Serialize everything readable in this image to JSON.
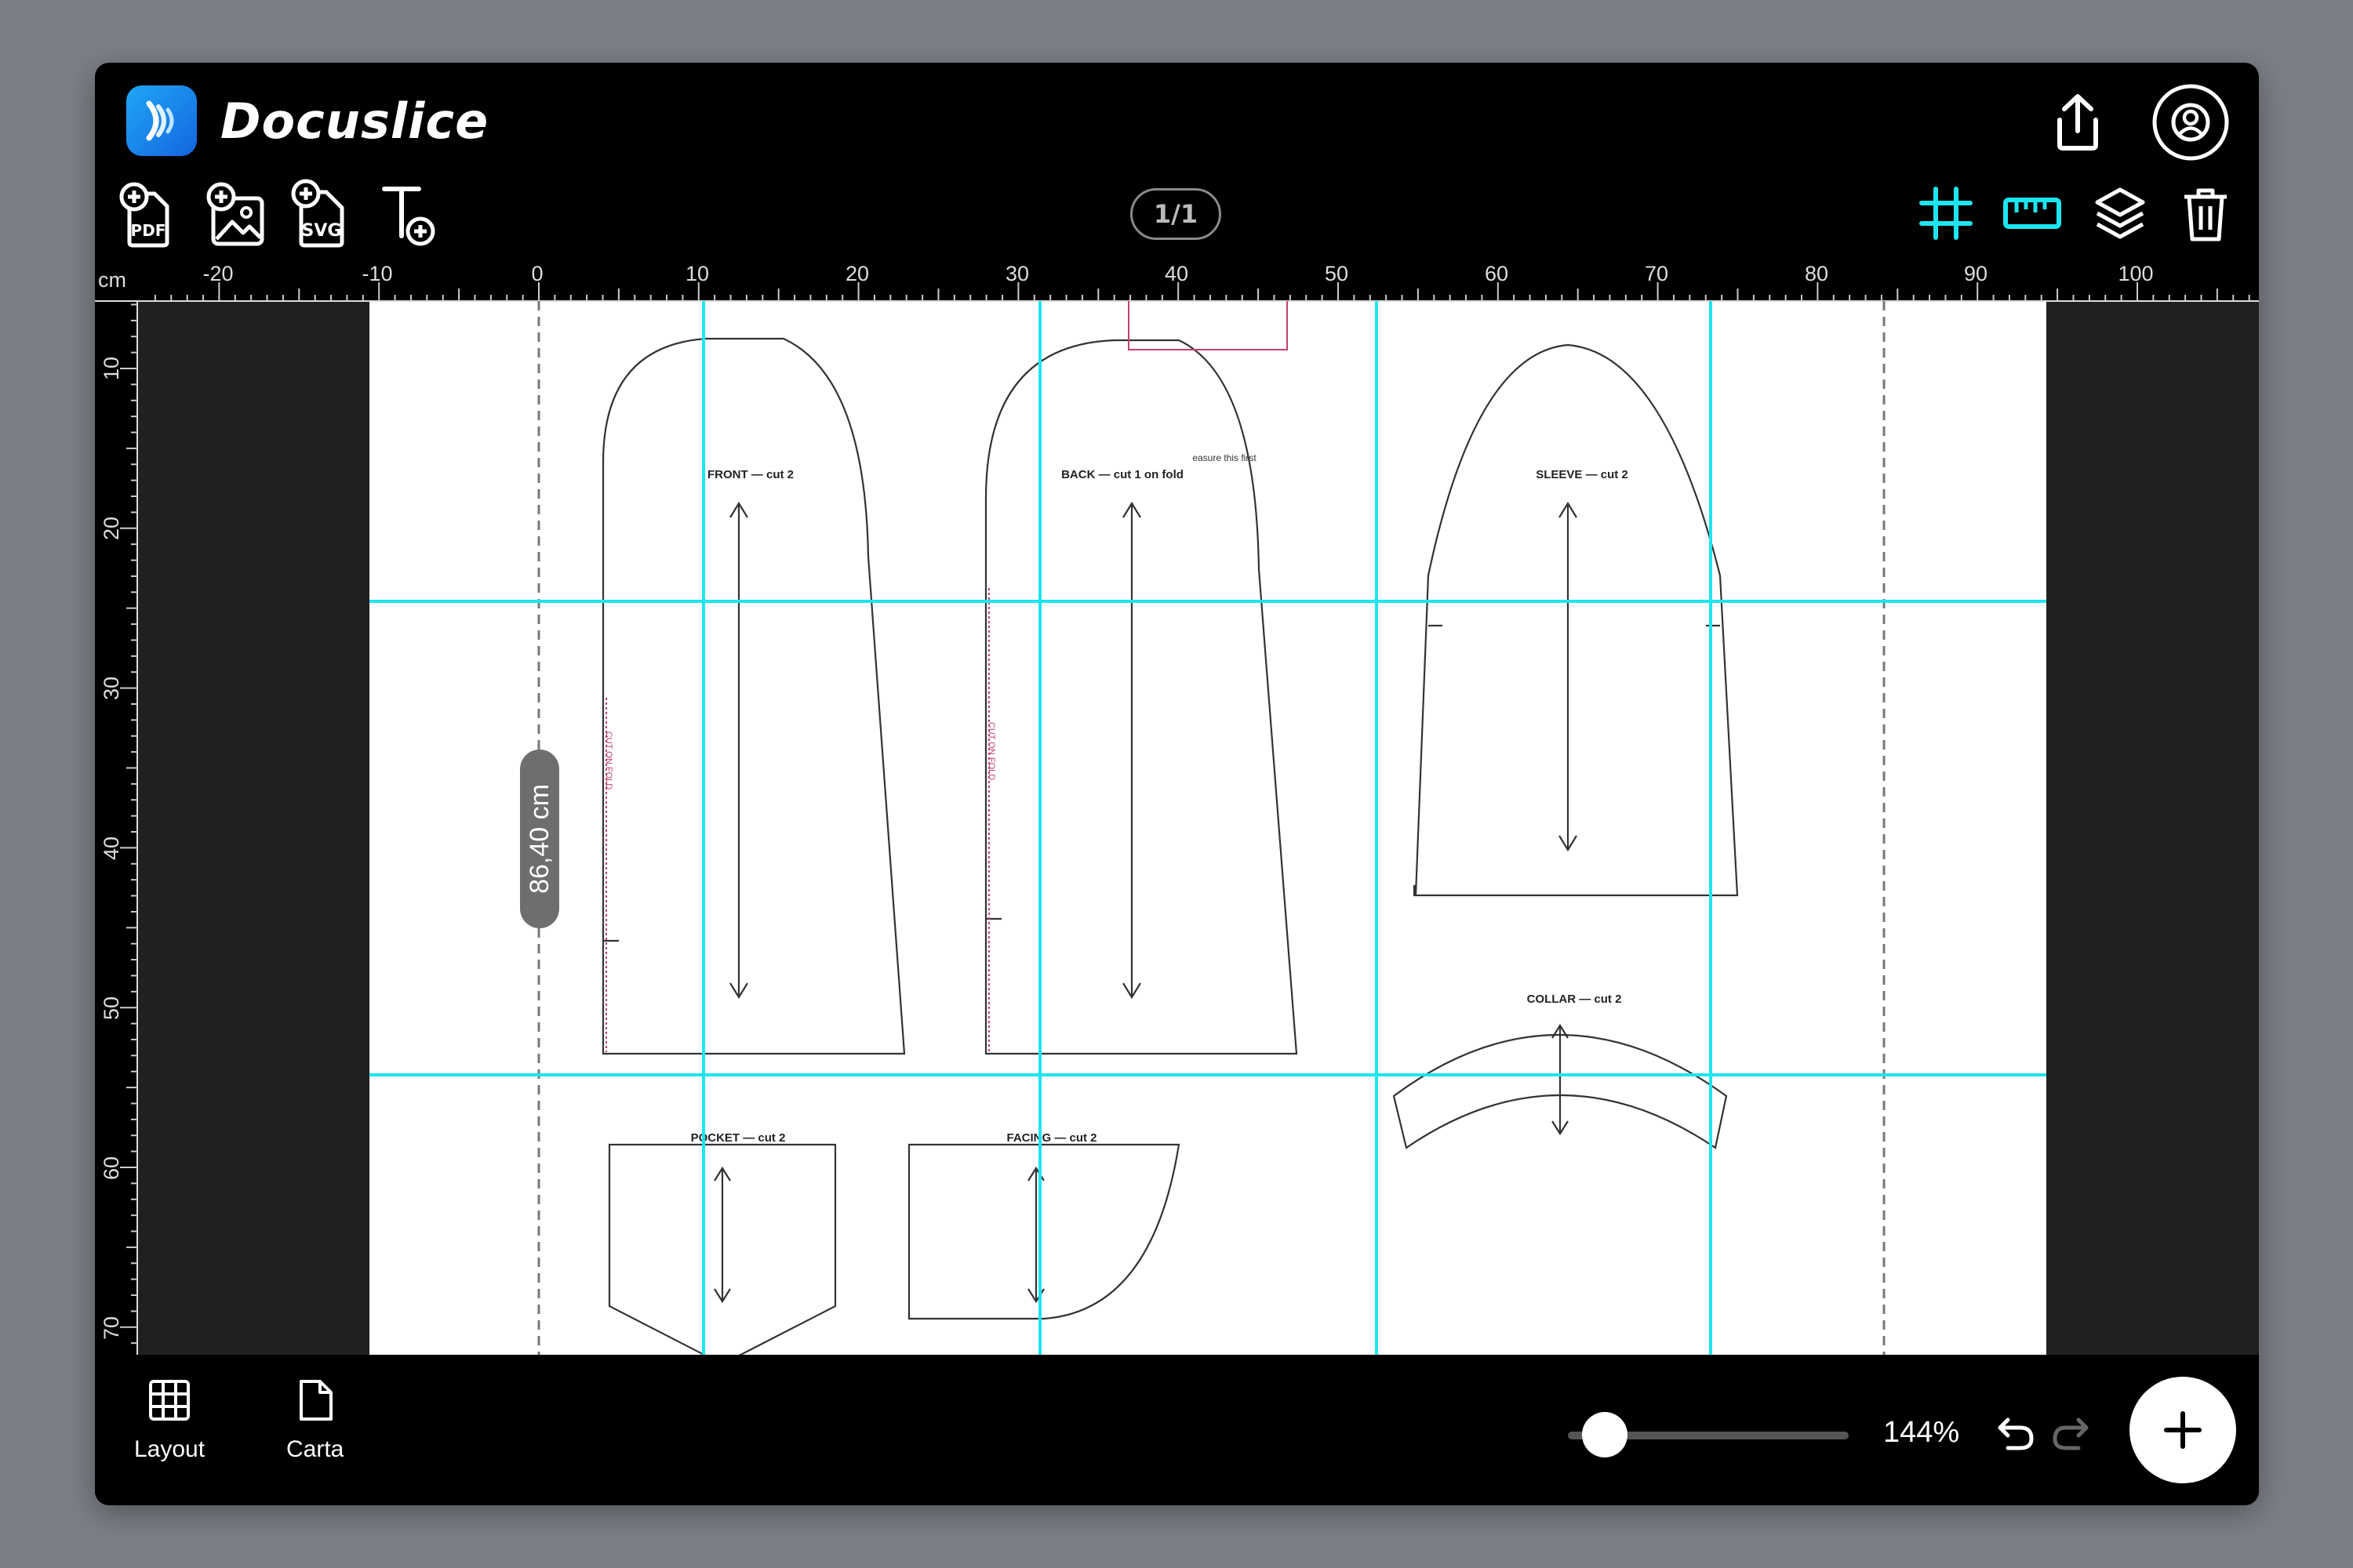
{
  "app": {
    "name": "Docuslice"
  },
  "toolbar": {
    "add_pdf": "PDF",
    "add_svg": "SVG",
    "page_indicator": "1/1"
  },
  "ruler": {
    "unit": "cm",
    "h_labels": [
      "-20",
      "-10",
      "0",
      "10",
      "20",
      "30",
      "40",
      "50",
      "60",
      "70",
      "80",
      "90",
      "100"
    ],
    "v_labels": [
      "10",
      "20",
      "30",
      "40",
      "50",
      "60",
      "70"
    ]
  },
  "canvas": {
    "measure_label": "86,40 cm",
    "pieces": {
      "front": "FRONT — cut 2",
      "back": "BACK — cut 1 on fold",
      "sleeve": "SLEEVE — cut 2",
      "collar": "COLLAR — cut 2",
      "pocket": "POCKET — cut 2",
      "facing": "FACING — cut 2",
      "measure_note": "easure this first",
      "fold": "CUT ON FOLD",
      "fold2": "CUT ON FOLD"
    }
  },
  "bottom": {
    "layout": "Layout",
    "carta": "Carta",
    "zoom": "144%",
    "zoom_level_percent": 10
  },
  "colors": {
    "accent": "#1de5ef",
    "background": "#000000",
    "sheet": "#ffffff"
  }
}
